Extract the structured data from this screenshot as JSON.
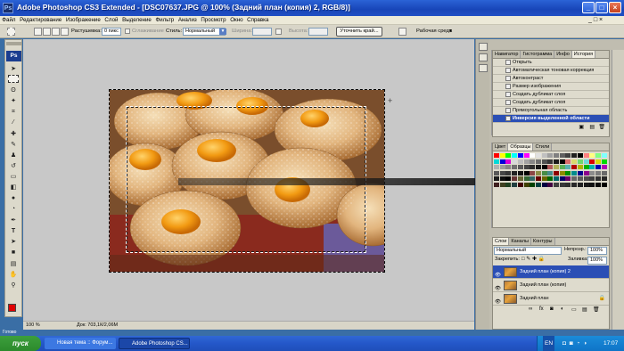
{
  "window": {
    "title": "Adobe Photoshop CS3 Extended - [DSC07637.JPG @ 100% (Задний план (копия) 2, RGB/8)]",
    "app_badge": "Ps"
  },
  "menu": [
    "Файл",
    "Редактирование",
    "Изображение",
    "Слой",
    "Выделение",
    "Фильтр",
    "Анализ",
    "Просмотр",
    "Окно",
    "Справка"
  ],
  "options": {
    "feather_label": "Растушевка:",
    "feather_value": "0 пикс",
    "antialias_label": "Сглаживание",
    "style_label": "Стиль:",
    "style_value": "Нормальный",
    "width_label": "Ширина:",
    "height_label": "Высота:",
    "refine_button": "Уточнить край...",
    "workspace_label": "Рабочая среда"
  },
  "status": {
    "zoom": "100 %",
    "doc_info": "Док: 703,1К/2,06М"
  },
  "history_panel": {
    "tabs": [
      "Навигатор",
      "Гистограмма",
      "Инфо",
      "История"
    ],
    "active_tab": "История",
    "items": [
      "Открыть",
      "Автоматическая тоновая коррекция",
      "Автоконтраст",
      "Размер изображения",
      "Создать дубликат слоя",
      "Создать дубликат слоя",
      "Прямоугольная область",
      "Инверсия выделенной области"
    ],
    "selected_index": 7
  },
  "swatches_panel": {
    "tabs": [
      "Цвет",
      "Образцы",
      "Стили"
    ],
    "active_tab": "Образцы"
  },
  "layers_panel": {
    "tabs": [
      "Слои",
      "Каналы",
      "Контуры"
    ],
    "active_tab": "Слои",
    "blend_mode": "Нормальный",
    "opacity_label": "Непрозр.:",
    "opacity_value": "100%",
    "lock_label": "Закрепить:",
    "fill_label": "Заливка:",
    "fill_value": "100%",
    "layers": [
      {
        "name": "Задний план (копия) 2",
        "selected": true
      },
      {
        "name": "Задний план (копия)",
        "selected": false
      },
      {
        "name": "Задний план",
        "selected": false
      }
    ]
  },
  "statusbar_label": "Готово",
  "taskbar": {
    "start": "пуск",
    "tasks": [
      "Новая тема :: Форум...",
      "Adobe Photoshop CS..."
    ],
    "lang": "EN",
    "time": "17:07"
  },
  "colors": {
    "title_blue": "#2458d0",
    "selection_blue": "#2b4fb5",
    "foreground_red": "#e00000"
  }
}
